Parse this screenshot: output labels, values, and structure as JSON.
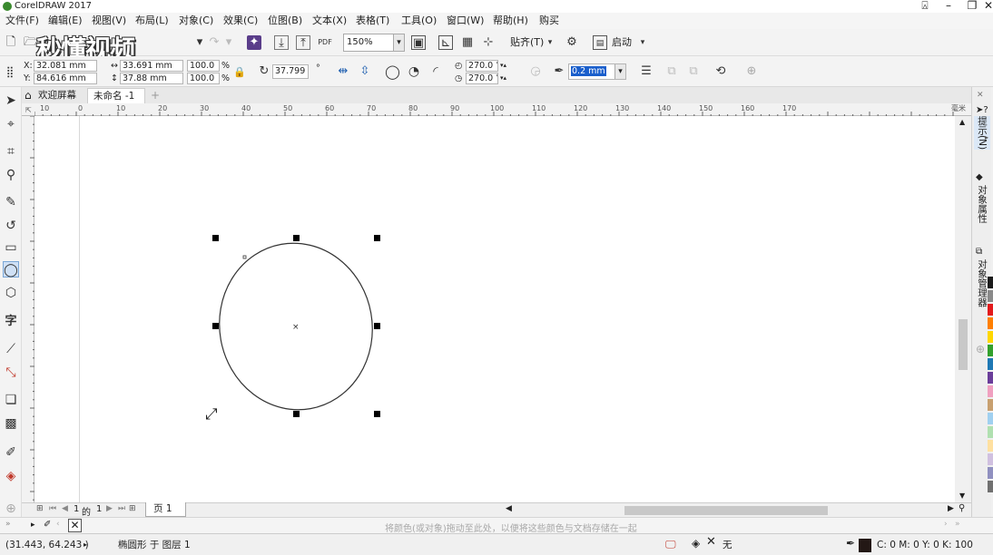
{
  "title": "CorelDRAW 2017",
  "menu": [
    "文件(F)",
    "编辑(E)",
    "视图(V)",
    "布局(L)",
    "对象(C)",
    "效果(C)",
    "位图(B)",
    "文本(X)",
    "表格(T)",
    "工具(O)",
    "窗口(W)",
    "帮助(H)",
    "购买"
  ],
  "toolbar": {
    "zoom": "150%",
    "snap_label": "贴齐(T)",
    "launch_label": "启动"
  },
  "watermark": "秒懂视频",
  "propbar": {
    "x_label": "X:",
    "x_value": "32.081 mm",
    "y_label": "Y:",
    "y_value": "84.616 mm",
    "w_value": "33.691 mm",
    "h_value": "37.88 mm",
    "scale_x": "100.0",
    "scale_y": "100.0",
    "percent": "%",
    "rotation": "37.799",
    "degree": "°",
    "start_angle": "270.0 °",
    "end_angle": "270.0 °",
    "outline_width": "0.2 mm"
  },
  "tabs": {
    "welcome": "欢迎屏幕",
    "doc": "未命名 -1"
  },
  "ruler_h": [
    "10",
    "0",
    "10",
    "20",
    "30",
    "40",
    "50",
    "60",
    "70",
    "80",
    "90",
    "100",
    "110",
    "120",
    "130",
    "140",
    "150",
    "160",
    "170"
  ],
  "ruler_unit": "毫米",
  "docker": {
    "hints": "提示(N)",
    "obj_props": "对象属性",
    "obj_manager": "对象管理器"
  },
  "pagebar": {
    "page_current": "1",
    "page_of": "的",
    "page_total": "1",
    "page_tab": "页 1"
  },
  "colorbar_hint": "将颜色(或对象)拖动至此处，以便将这些颜色与文档存储在一起",
  "status": {
    "coords": "(31.443, 64.243 )",
    "object_info": "椭圆形 于 图层 1",
    "fill": "无",
    "outline_color": "C: 0 M: 0 Y: 0 K: 100"
  },
  "colors": {
    "palette": [
      "#1b1b1b",
      "#8a8a8a",
      "#e31a1c",
      "#ff7f00",
      "#ffd700",
      "#33a02c",
      "#1f78b4",
      "#6a3d9a",
      "#f0a0c0",
      "#c8a070",
      "#a0d0f0",
      "#b0e0b0",
      "#ffe0a0",
      "#d0c0e0",
      "#9090c0",
      "#707070"
    ]
  }
}
